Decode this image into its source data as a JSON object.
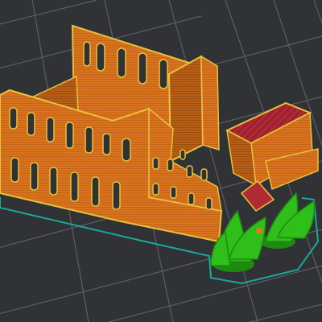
{
  "viewport": {
    "scene": "sliced-model-preview",
    "colors": {
      "background": "#303236",
      "grid_line": "#5c5e62",
      "wall_orange": "#d9731e",
      "wall_dark": "#a95512",
      "wall_edge": "#e8c23a",
      "top_fill": "#b02a34",
      "support_green": "#2fbf1a",
      "support_dark": "#1e8a10",
      "skirt_teal": "#1aa89a"
    },
    "icons": {
      "model": "sliced-castle-model-icon",
      "supports": "tree-supports-icon",
      "skirt": "skirt-outline-icon",
      "bed": "build-plate-grid-icon"
    }
  }
}
